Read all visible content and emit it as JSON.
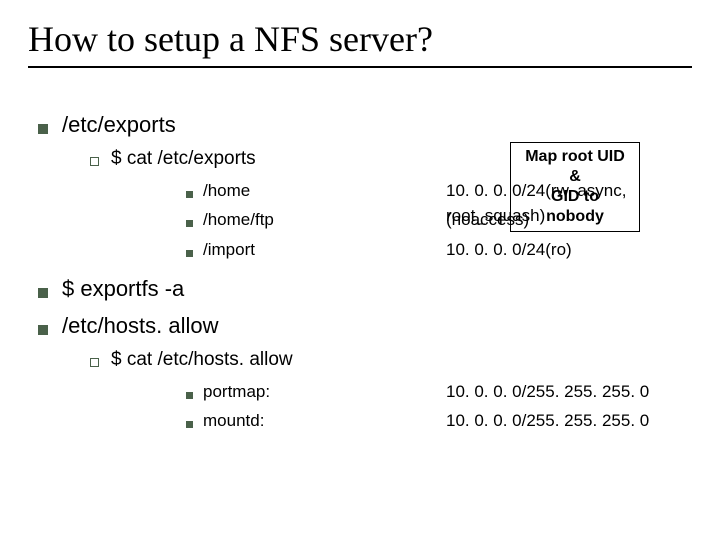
{
  "title": "How to setup a NFS server?",
  "callout": {
    "line1": "Map root UID &",
    "line2": "GID to nobody"
  },
  "items": {
    "i0": {
      "label": "/etc/exports",
      "sub": {
        "s0": {
          "label": "$ cat /etc/exports",
          "rows": {
            "r0": {
              "k": "/home",
              "v": "10. 0. 0. 0/24(rw, async, root_squash)"
            },
            "r1": {
              "k": "/home/ftp",
              "v": "(noaccess)"
            },
            "r2": {
              "k": "/import",
              "v": "10. 0. 0. 0/24(ro)"
            }
          }
        }
      }
    },
    "i1": {
      "label": "$ exportfs -a"
    },
    "i2": {
      "label": "/etc/hosts. allow",
      "sub": {
        "s0": {
          "label": "$ cat /etc/hosts. allow",
          "rows": {
            "r0": {
              "k": "portmap:",
              "v": "10. 0. 0. 0/255. 255. 255. 0"
            },
            "r1": {
              "k": "mountd:",
              "v": "10. 0. 0. 0/255. 255. 255. 0"
            }
          }
        }
      }
    }
  }
}
